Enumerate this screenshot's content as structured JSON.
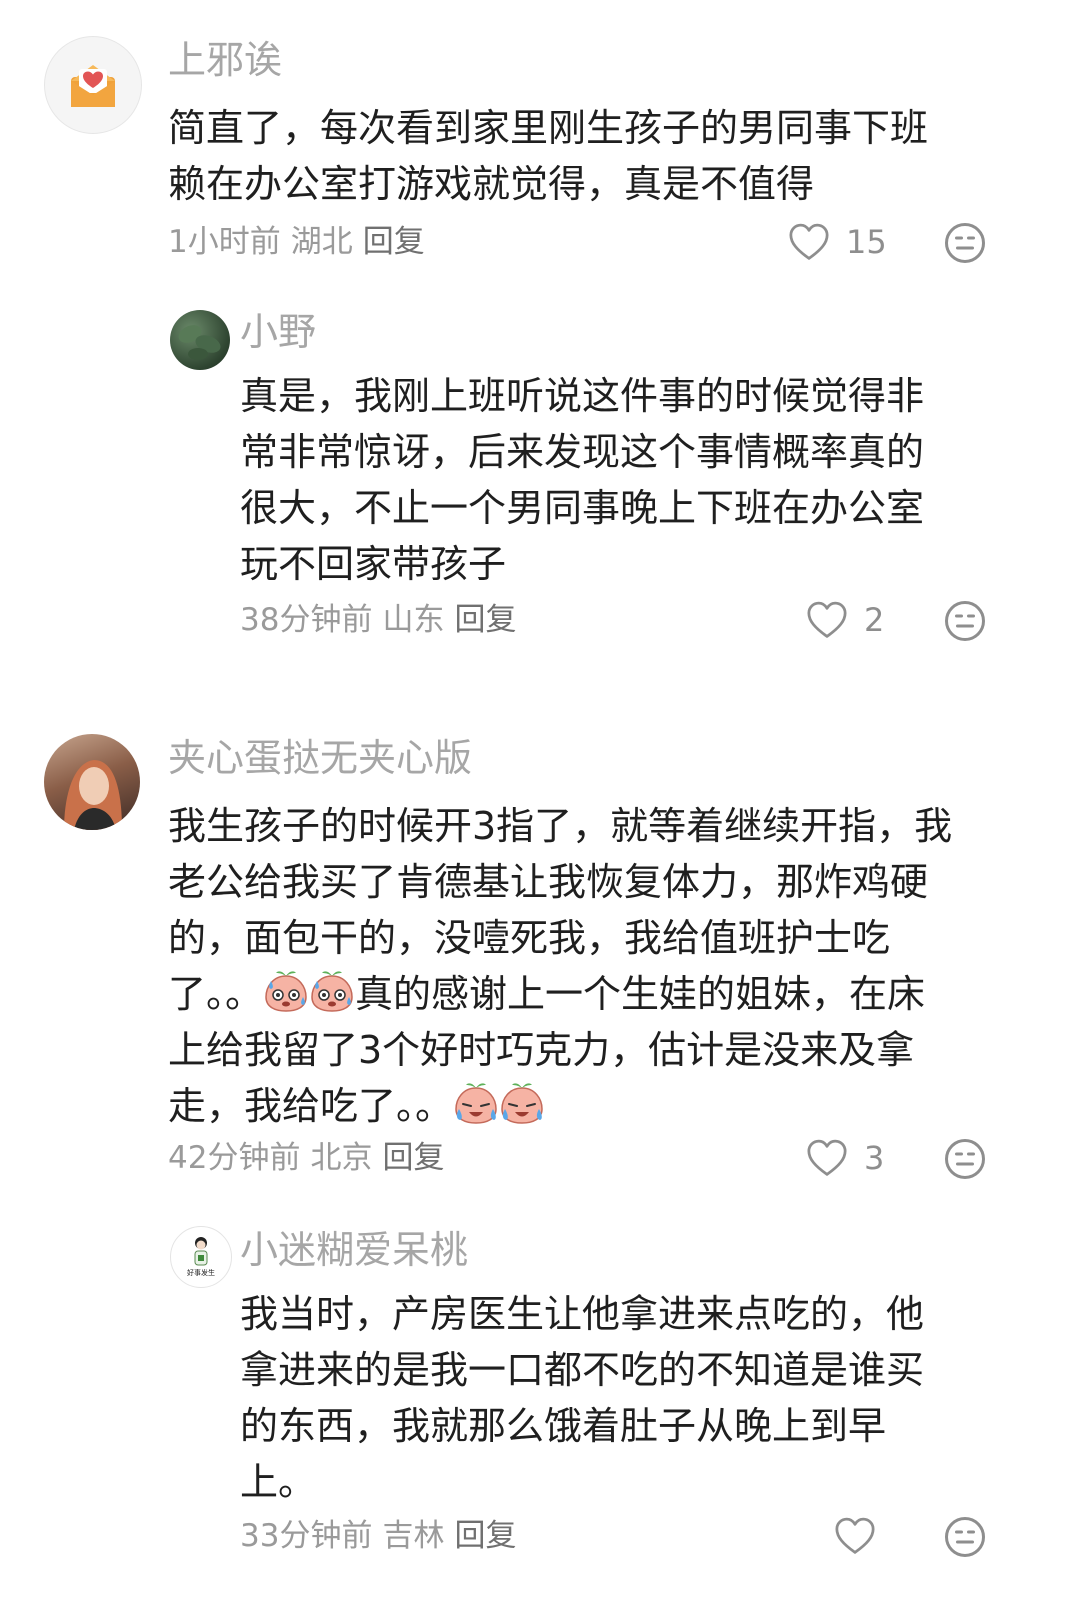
{
  "colors": {
    "name": "#a6a6a6",
    "text": "#1f1f1f",
    "meta": "#9a9a9a",
    "icon": "#8e8e8e"
  },
  "comments": [
    {
      "user": "上邪诶",
      "lines": [
        "简直了，每次看到家里刚生孩子的男同事下班",
        "赖在办公室打游戏就觉得，真是不值得"
      ],
      "time": "1小时前",
      "location": "湖北",
      "reply": "回复",
      "likes": "15",
      "avatar_icon": "envelope-heart-icon"
    },
    {
      "user": "小野",
      "lines": [
        "真是，我刚上班听说这件事的时候觉得非",
        "常非常惊讶，后来发现这个事情概率真的",
        "很大，不止一个男同事晚上下班在办公室",
        "玩不回家带孩子"
      ],
      "time": "38分钟前",
      "location": "山东",
      "reply": "回复",
      "likes": "2",
      "avatar_icon": "leaf-photo-icon"
    },
    {
      "user": "夹心蛋挞无夹心版",
      "lines": [
        "我生孩子的时候开3指了，就等着继续开指，我",
        "老公给我买了肯德基让我恢复体力，那炸鸡硬",
        "的，面包干的，没噎死我，我给值班护士吃"
      ],
      "line4_start": "了。。",
      "line4_end": "真的感谢上一个生娃的姐妹，在床",
      "line5": "上给我留了3个好时巧克力，估计是没来及拿",
      "line6_start": "走，我给吃了。。",
      "time": "42分钟前",
      "location": "北京",
      "reply": "回复",
      "likes": "3",
      "avatar_icon": "woman-photo-icon"
    },
    {
      "user": "小迷糊爱呆桃",
      "lines": [
        "我当时，产房医生让他拿进来点吃的，他",
        "拿进来的是我一口都不吃的不知道是谁买",
        "的东西，我就那么饿着肚子从晚上到早",
        "上。"
      ],
      "time": "33分钟前",
      "location": "吉林",
      "reply": "回复",
      "likes": "",
      "avatar_icon": "cartoon-avatar-icon",
      "avatar_text": "好事发生"
    }
  ]
}
